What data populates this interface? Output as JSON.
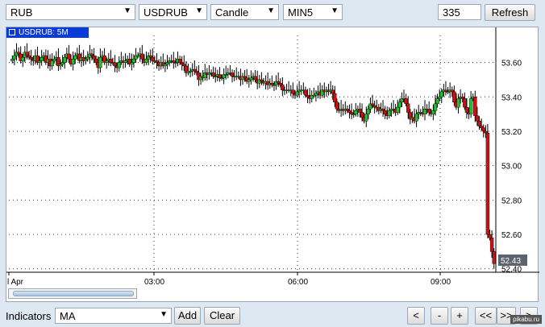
{
  "toolbar": {
    "currency": "RUB",
    "pair": "USDRUB",
    "chart_type": "Candle",
    "interval": "MIN5",
    "bars": "335",
    "refresh_label": "Refresh"
  },
  "chart": {
    "tag": "USDRUB: 5M",
    "last_price": "52.43",
    "colors": {
      "up": "#22c02c",
      "down": "#cc1111",
      "wick": "#000000",
      "tag_bg": "#0a3bd6",
      "grid": "#333333"
    }
  },
  "chart_data": {
    "type": "candlestick",
    "y_ticks": [
      "53.60",
      "53.40",
      "53.20",
      "53.00",
      "52.80",
      "52.60",
      "52.40"
    ],
    "ylim": [
      52.38,
      53.72
    ],
    "x_ticks": [
      "l Apr",
      "03:00",
      "06:00",
      "09:00"
    ],
    "series": [
      {
        "name": "USDRUB: 5M",
        "close": [
          53.62,
          53.64,
          53.66,
          53.65,
          53.61,
          53.63,
          53.66,
          53.64,
          53.63,
          53.62,
          53.61,
          53.64,
          53.6,
          53.61,
          53.63,
          53.64,
          53.6,
          53.62,
          53.58,
          53.61,
          53.62,
          53.63,
          53.58,
          53.59,
          53.6,
          53.63,
          53.65,
          53.62,
          53.59,
          53.62,
          53.64,
          53.65,
          53.61,
          53.63,
          53.61,
          53.62,
          53.63,
          53.65,
          53.64,
          53.62,
          53.6,
          53.57,
          53.63,
          53.64,
          53.6,
          53.61,
          53.62,
          53.6,
          53.6,
          53.58,
          53.57,
          53.6,
          53.61,
          53.6,
          53.61,
          53.62,
          53.59,
          53.6,
          53.62,
          53.64,
          53.64,
          53.65,
          53.62,
          53.6,
          53.62,
          53.64,
          53.63,
          53.61,
          53.61,
          53.6,
          53.58,
          53.6,
          53.58,
          53.59,
          53.6,
          53.61,
          53.61,
          53.6,
          53.6,
          53.62,
          53.6,
          53.59,
          53.58,
          53.54,
          53.55,
          53.55,
          53.56,
          53.55,
          53.54,
          53.5,
          53.52,
          53.51,
          53.54,
          53.53,
          53.54,
          53.54,
          53.52,
          53.52,
          53.53,
          53.51,
          53.51,
          53.53,
          53.53,
          53.54,
          53.54,
          53.52,
          53.52,
          53.52,
          53.52,
          53.5,
          53.52,
          53.51,
          53.49,
          53.5,
          53.51,
          53.52,
          53.5,
          53.48,
          53.5,
          53.49,
          53.48,
          53.49,
          53.47,
          53.48,
          53.47,
          53.47,
          53.49,
          53.48,
          53.47,
          53.44,
          53.44,
          53.44,
          53.44,
          53.44,
          53.42,
          53.41,
          53.43,
          53.44,
          53.44,
          53.44,
          53.41,
          53.4,
          53.39,
          53.41,
          53.41,
          53.42,
          53.43,
          53.41,
          53.44,
          53.43,
          53.44,
          53.43,
          53.44,
          53.42,
          53.37,
          53.33,
          53.32,
          53.33,
          53.32,
          53.33,
          53.32,
          53.31,
          53.3,
          53.3,
          53.32,
          53.33,
          53.31,
          53.28,
          53.26,
          53.3,
          53.33,
          53.36,
          53.35,
          53.34,
          53.34,
          53.32,
          53.33,
          53.32,
          53.3,
          53.29,
          53.32,
          53.33,
          53.33,
          53.31,
          53.34,
          53.37,
          53.39,
          53.39,
          53.36,
          53.31,
          53.27,
          53.28,
          53.26,
          53.3,
          53.31,
          53.31,
          53.3,
          53.33,
          53.33,
          53.31,
          53.3,
          53.32,
          53.36,
          53.39,
          53.4,
          53.43,
          53.44,
          53.43,
          53.43,
          53.44,
          53.43,
          53.37,
          53.34,
          53.39,
          53.4,
          53.39,
          53.34,
          53.31,
          53.3,
          53.39,
          53.4,
          53.29,
          53.26,
          53.23,
          53.22,
          53.2,
          53.19,
          52.6,
          52.58,
          52.5,
          52.43
        ]
      }
    ]
  },
  "bottom": {
    "indicators_label": "Indicators",
    "indicator_value": "MA",
    "add_label": "Add",
    "clear_label": "Clear",
    "zoom_out_label": "<",
    "minus_label": "-",
    "plus_label": "+",
    "rewind_label": "<<",
    "forward_label": ">>",
    "end_label": ">",
    "watermark": "pikabu.ru"
  }
}
